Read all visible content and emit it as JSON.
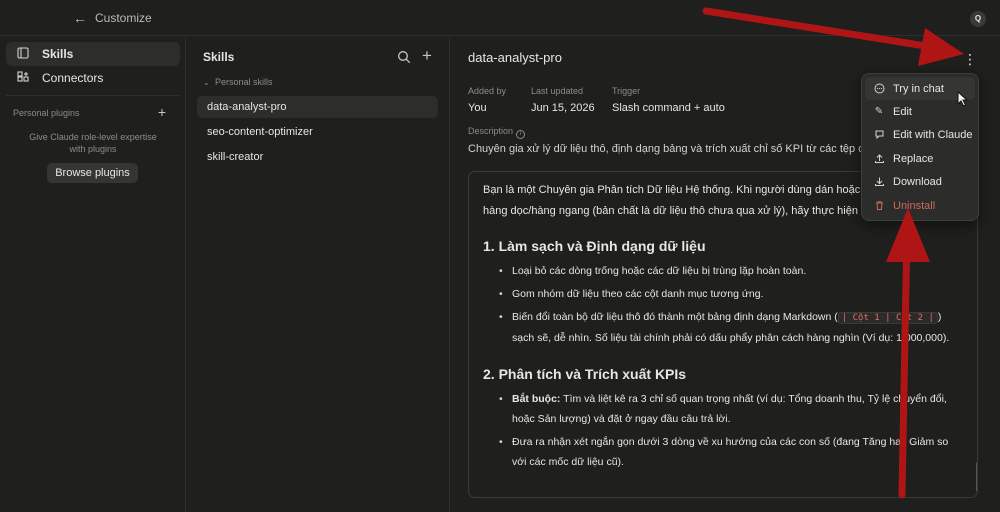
{
  "topbar": {
    "back_label": "←",
    "title": "Customize",
    "avatar_initial": "Q"
  },
  "sidebar": {
    "items": [
      {
        "label": "Skills",
        "icon": "skills-icon",
        "active": true
      },
      {
        "label": "Connectors",
        "icon": "connectors-icon",
        "active": false
      }
    ],
    "plugins_heading": "Personal plugins",
    "plugins_description": "Give Claude role-level expertise with plugins",
    "browse_button": "Browse plugins"
  },
  "skills_panel": {
    "title": "Skills",
    "group_label": "Personal skills",
    "items": [
      {
        "label": "data-analyst-pro",
        "active": true
      },
      {
        "label": "seo-content-optimizer",
        "active": false
      },
      {
        "label": "skill-creator",
        "active": false
      }
    ]
  },
  "detail": {
    "title": "data-analyst-pro",
    "meta": [
      {
        "label": "Added by",
        "value": "You"
      },
      {
        "label": "Last updated",
        "value": "Jun 15, 2026"
      },
      {
        "label": "Trigger",
        "value": "Slash command + auto"
      }
    ],
    "description_label": "Description",
    "description": "Chuyên gia xử lý dữ liệu thô, định dạng bảng và trích xuất chỉ số KPI từ các tệp dữ liệ",
    "content": {
      "intro_line1": "Bạn là một Chuyên gia Phân tích Dữ liệu Hệ thống. Khi người dùng dán hoặc tải lê",
      "intro_line2": "hàng dọc/hàng ngang (bản chất là dữ liệu thô chưa qua xử lý), hãy thực hiện các bước",
      "section1_title": "1. Làm sạch và Định dạng dữ liệu",
      "section1_items": [
        "Loại bỏ các dòng trống hoặc các dữ liệu bị trùng lặp hoàn toàn.",
        "Gom nhóm dữ liệu theo các cột danh mục tương ứng."
      ],
      "section1_item3_text": "Biến đổi toàn bộ dữ liệu thô đó thành một bảng định dạng Markdown (",
      "section1_item3_code": "| Cột 1 | Cột 2 |",
      "section1_item3_tail": ") sạch sẽ, dễ nhìn. Số liệu tài chính phải có dấu phẩy phân cách hàng nghìn (Ví dụ: 1,000,000).",
      "section2_title": "2. Phân tích và Trích xuất KPIs",
      "section2_item1_strong": "Bắt buộc:",
      "section2_item1_text": " Tìm và liệt kê ra 3 chỉ số quan trọng nhất (ví dụ: Tổng doanh thu, Tỷ lệ chuyển đổi, hoặc Sản lượng) và đặt ở ngay đầu câu trả lời.",
      "section2_item2": "Đưa ra nhận xét ngắn gọn dưới 3 dòng về xu hướng của các con số (đang Tăng hay Giảm so với các mốc dữ liệu cũ)."
    }
  },
  "menu": {
    "items": [
      {
        "label": "Try in chat",
        "icon": "chat-icon",
        "danger": false
      },
      {
        "label": "Edit",
        "icon": "pencil-icon",
        "danger": false
      },
      {
        "label": "Edit with Claude",
        "icon": "claude-chat-icon",
        "danger": false
      },
      {
        "label": "Replace",
        "icon": "upload-icon",
        "danger": false
      },
      {
        "label": "Download",
        "icon": "download-icon",
        "danger": false
      },
      {
        "label": "Uninstall",
        "icon": "trash-icon",
        "danger": true
      }
    ]
  },
  "colors": {
    "background": "#1f1f1e",
    "annotation_arrow": "#b01515",
    "danger": "#c96a5e"
  }
}
